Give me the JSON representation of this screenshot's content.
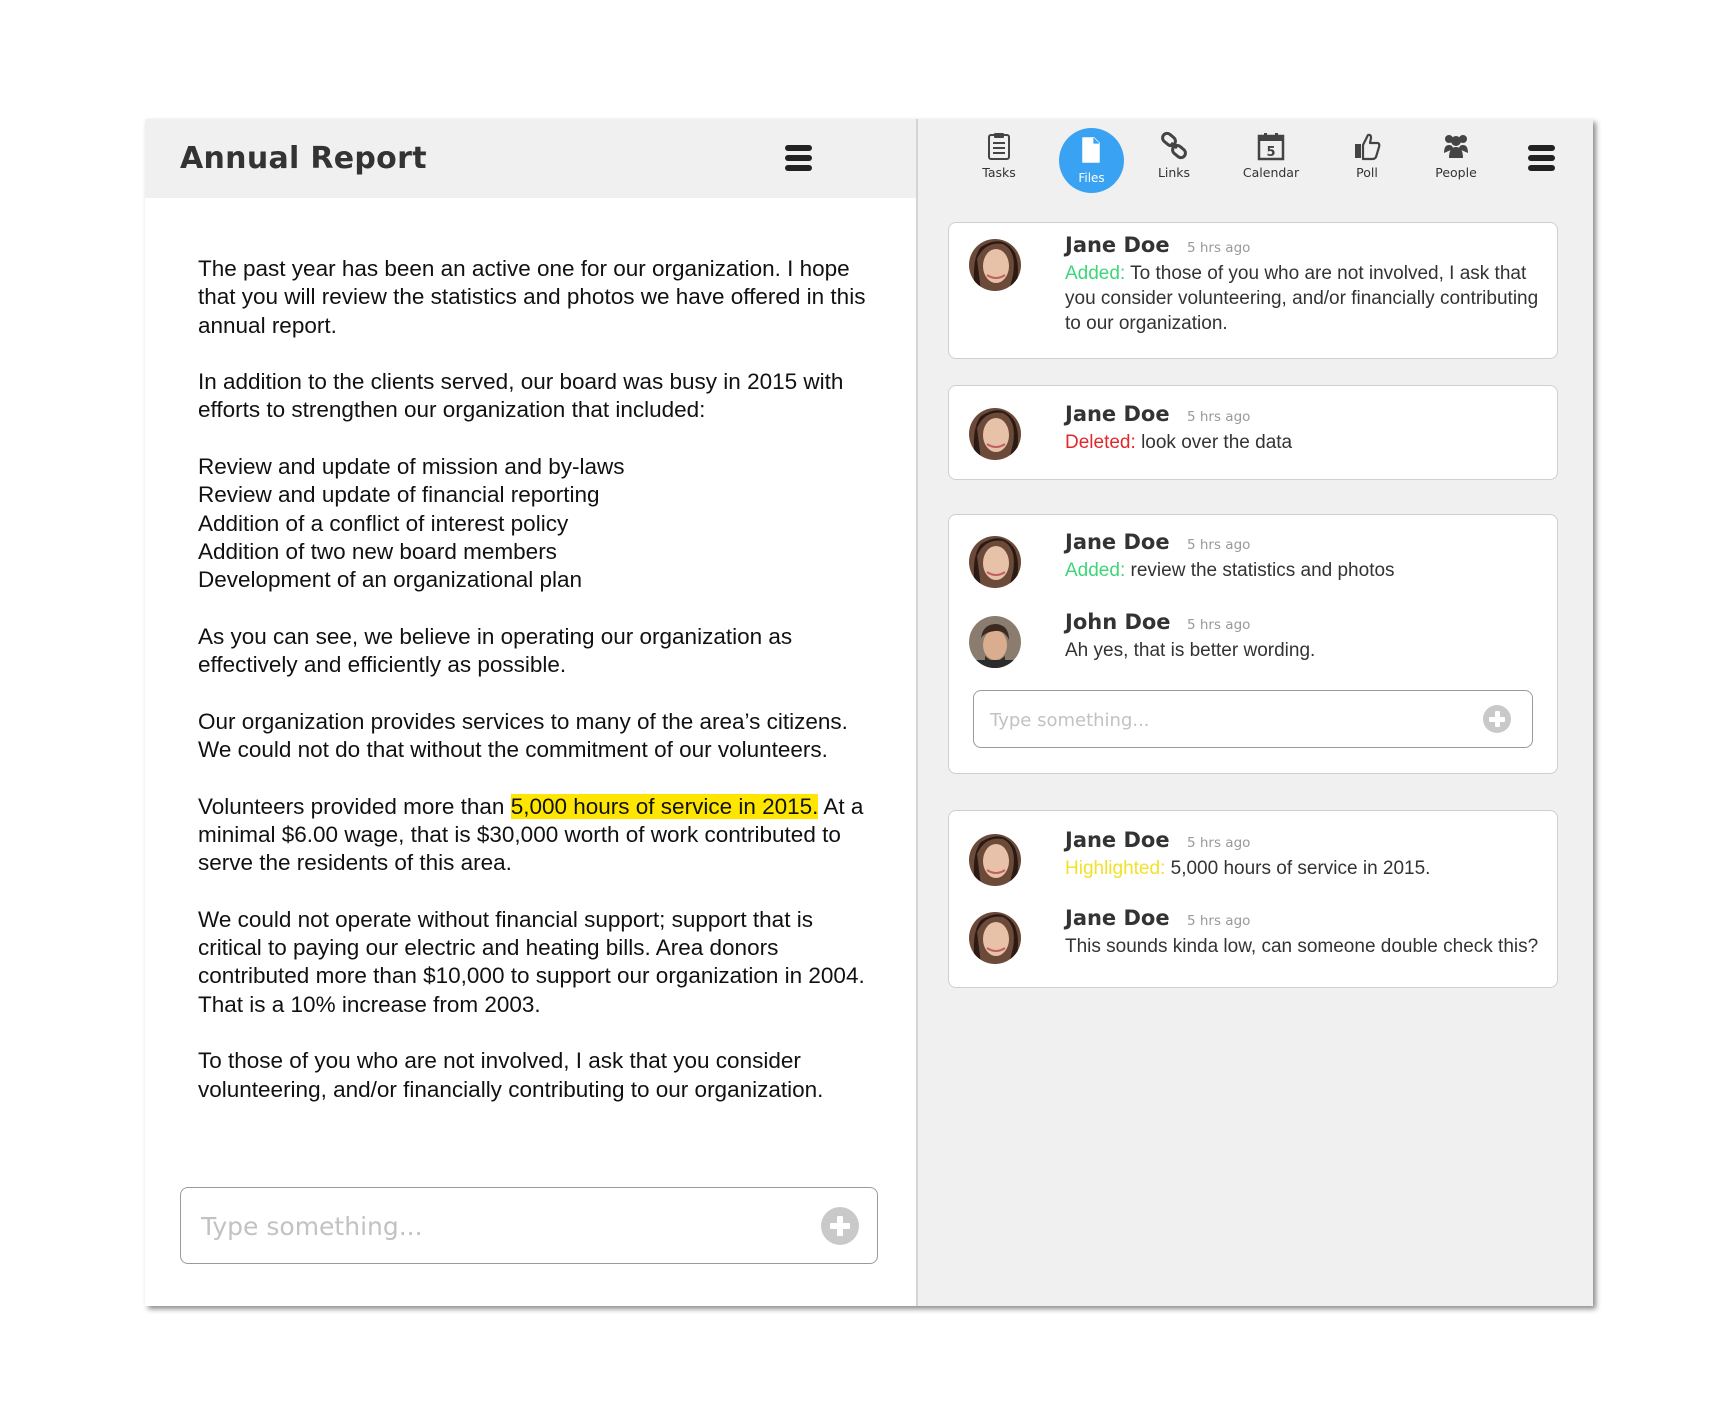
{
  "document": {
    "title": "Annual Report",
    "paragraphs": {
      "p1": "The past year has been an active one for our organization. I hope that you will review the statistics and photos we have offered in this annual report.",
      "p2": "In addition to the clients served, our board was busy in 2015 with efforts to strengthen our organization that included:",
      "list": [
        "Review and update of mission and by-laws",
        "Review and update of financial reporting",
        "Addition of a conflict of interest policy",
        "Addition of two new board members",
        "Development of an organizational plan"
      ],
      "p3": "As you can see, we believe in operating our organization as effectively and efficiently as possible.",
      "p4": "Our organization provides services to many of the area’s citizens. We could not do that without the commitment of our volunteers.",
      "p5_before": "Volunteers provided more than ",
      "p5_highlight": "5,000 hours of service in 2015.",
      "p5_after": " At a minimal $6.00 wage, that is $30,000 worth of work contributed to serve the residents of this area.",
      "p6": "We could not operate without financial support; support that is critical to paying our electric and heating bills. Area donors contributed more than $10,000 to support our organization in 2004. That is a 10% increase from 2003.",
      "p7": "To those of you who are not involved, I ask that you consider volunteering, and/or financially contributing to our organization."
    },
    "input_placeholder": "Type something..."
  },
  "toolbar": {
    "tasks": "Tasks",
    "files": "Files",
    "links": "Links",
    "calendar": "Calendar",
    "calendar_day": "5",
    "poll": "Poll",
    "people": "People"
  },
  "threads": [
    {
      "comments": [
        {
          "name": "Jane Doe",
          "time": "5 hrs ago",
          "action": "Added:",
          "text": "To those of you who are not involved, I ask that you consider volunteering, and/or financially contributing to our organization."
        }
      ]
    },
    {
      "comments": [
        {
          "name": "Jane Doe",
          "time": "5 hrs ago",
          "action": "Deleted:",
          "text": "look over the data"
        }
      ]
    },
    {
      "comments": [
        {
          "name": "Jane Doe",
          "time": "5 hrs ago",
          "action": "Added:",
          "text": "review  the statistics and photos"
        },
        {
          "name": "John Doe",
          "time": "5 hrs ago",
          "action": "",
          "text": "Ah yes, that is better wording."
        }
      ],
      "input_placeholder": "Type something..."
    },
    {
      "comments": [
        {
          "name": "Jane Doe",
          "time": "5 hrs ago",
          "action": "Highlighted:",
          "text": "5,000 hours of service in 2015."
        },
        {
          "name": "Jane Doe",
          "time": "5 hrs ago",
          "action": "",
          "text": "This sounds kinda low, can someone double check this?"
        }
      ]
    }
  ],
  "colors": {
    "added": "#3ed67a",
    "deleted": "#e1282d",
    "highlighted": "#f2e12a",
    "active_tab": "#3aa2f3",
    "highlight_bg": "#ffe600"
  },
  "icons": [
    "menu-icon",
    "clipboard-icon",
    "file-icon",
    "link-icon",
    "calendar-icon",
    "thumbs-up-icon",
    "people-icon",
    "plus-icon"
  ]
}
